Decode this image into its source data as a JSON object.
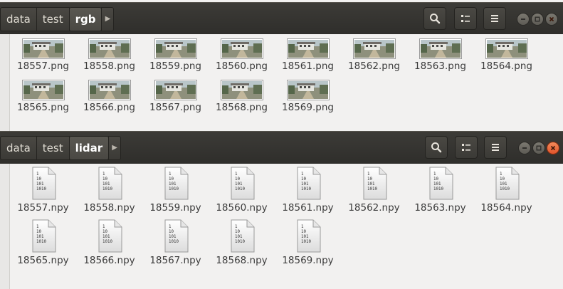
{
  "windows": [
    {
      "breadcrumbs": [
        "data",
        "test",
        "rgb"
      ],
      "active_crumb": 2,
      "files": [
        "18557.png",
        "18558.png",
        "18559.png",
        "18560.png",
        "18561.png",
        "18562.png",
        "18563.png",
        "18564.png",
        "18565.png",
        "18566.png",
        "18567.png",
        "18568.png",
        "18569.png"
      ],
      "file_icon": "image-thumbnail"
    },
    {
      "breadcrumbs": [
        "data",
        "test",
        "lidar"
      ],
      "active_crumb": 2,
      "files": [
        "18557.npy",
        "18558.npy",
        "18559.npy",
        "18560.npy",
        "18561.npy",
        "18562.npy",
        "18563.npy",
        "18564.npy",
        "18565.npy",
        "18566.npy",
        "18567.npy",
        "18568.npy",
        "18569.npy"
      ],
      "file_icon": "binary-file-icon",
      "binary_icon_text": [
        "1",
        "10",
        "101",
        "1010"
      ]
    }
  ],
  "colors": {
    "headerbar": "#3c3b37",
    "content_bg": "#f2f1f0",
    "close_button": "#e2542b"
  }
}
